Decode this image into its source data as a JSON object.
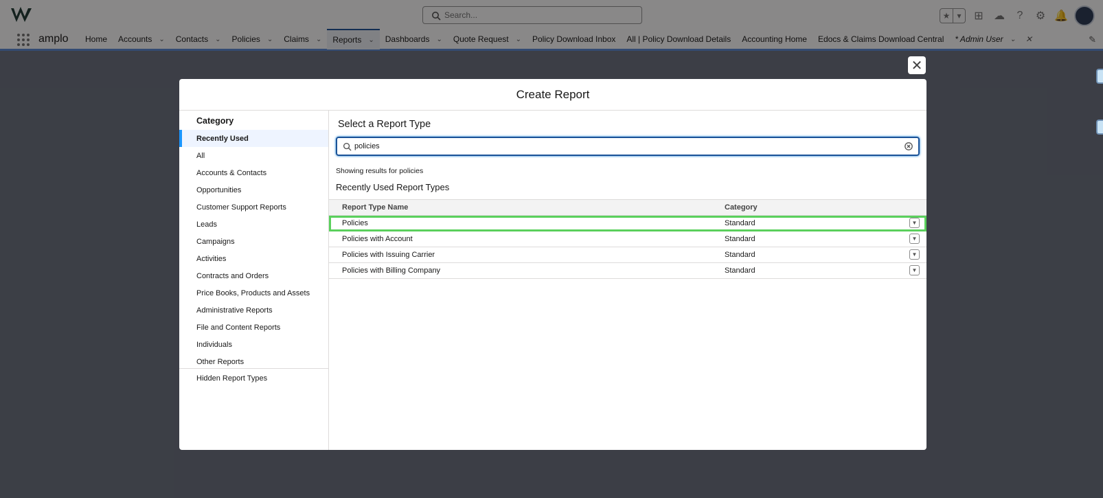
{
  "header": {
    "search_placeholder": "Search...",
    "app_name": "amplo",
    "nav": [
      {
        "label": "Home",
        "dropdown": false
      },
      {
        "label": "Accounts",
        "dropdown": true
      },
      {
        "label": "Contacts",
        "dropdown": true
      },
      {
        "label": "Policies",
        "dropdown": true
      },
      {
        "label": "Claims",
        "dropdown": true
      },
      {
        "label": "Reports",
        "dropdown": true,
        "active": true
      },
      {
        "label": "Dashboards",
        "dropdown": true
      },
      {
        "label": "Quote Request",
        "dropdown": true
      },
      {
        "label": "Policy Download Inbox",
        "dropdown": false
      },
      {
        "label": "All | Policy Download Details",
        "dropdown": false
      },
      {
        "label": "Accounting Home",
        "dropdown": false
      },
      {
        "label": "Edocs & Claims Download Central",
        "dropdown": false
      },
      {
        "label": "* Admin User",
        "dropdown": true,
        "closable": true
      }
    ],
    "icons": [
      "favorites-star-icon",
      "add-icon",
      "trailhead-icon",
      "help-icon",
      "setup-gear-icon",
      "notifications-bell-icon"
    ]
  },
  "modal": {
    "title": "Create Report",
    "category_heading": "Category",
    "categories": [
      "Recently Used",
      "All",
      "Accounts & Contacts",
      "Opportunities",
      "Customer Support Reports",
      "Leads",
      "Campaigns",
      "Activities",
      "Contracts and Orders",
      "Price Books, Products and Assets",
      "Administrative Reports",
      "File and Content Reports",
      "Individuals",
      "Other Reports"
    ],
    "selected_category": "Recently Used",
    "hidden_types": "Hidden Report Types",
    "select_heading": "Select a Report Type",
    "search_value": "policies",
    "results_note": "Showing results for policies",
    "recent_heading": "Recently Used Report Types",
    "table": {
      "columns": [
        "Report Type Name",
        "Category"
      ],
      "rows": [
        {
          "name": "Policies",
          "category": "Standard",
          "highlighted": true
        },
        {
          "name": "Policies with Account",
          "category": "Standard"
        },
        {
          "name": "Policies with Issuing Carrier",
          "category": "Standard"
        },
        {
          "name": "Policies with Billing Company",
          "category": "Standard"
        }
      ]
    }
  },
  "colors": {
    "highlight": "#5ad05c",
    "selected_bar": "#1b96ff",
    "focus_border": "#1b5297"
  }
}
